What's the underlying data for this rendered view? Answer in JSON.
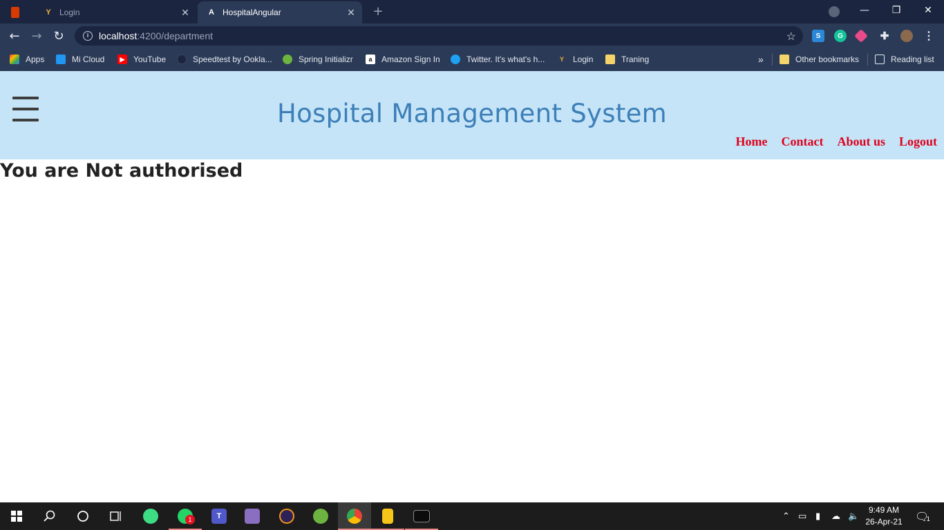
{
  "browser": {
    "tabs": [
      {
        "title": "Login"
      },
      {
        "title": "HospitalAngular"
      }
    ],
    "url_host": "localhost",
    "url_rest": ":4200/department",
    "bookmarks": [
      {
        "label": "Apps",
        "icon": "apps-grid-icon"
      },
      {
        "label": "Mi Cloud",
        "icon": "mi-cloud-icon"
      },
      {
        "label": "YouTube",
        "icon": "youtube-icon"
      },
      {
        "label": "Speedtest by Ookla...",
        "icon": "speedtest-icon"
      },
      {
        "label": "Spring Initializr",
        "icon": "spring-icon"
      },
      {
        "label": "Amazon Sign In",
        "icon": "amazon-icon"
      },
      {
        "label": "Twitter. It's what's h...",
        "icon": "twitter-icon"
      },
      {
        "label": "Login",
        "icon": "login-icon"
      },
      {
        "label": "Traning",
        "icon": "folder-icon"
      }
    ],
    "other_bookmarks": "Other bookmarks",
    "reading_list": "Reading list",
    "more_bookmarks": "»"
  },
  "site": {
    "title": "Hospital Management System",
    "nav": [
      {
        "label": "Home"
      },
      {
        "label": "Contact"
      },
      {
        "label": "About us"
      },
      {
        "label": "Logout"
      }
    ],
    "message": "You are Not authorised"
  },
  "taskbar": {
    "whatsapp_badge": "1",
    "time": "9:49 AM",
    "date": "26-Apr-21",
    "notification_count": "1"
  },
  "colors": {
    "header_bg": "#c5e4f7",
    "title_color": "#3d7fb8",
    "nav_color": "#e0001b"
  }
}
